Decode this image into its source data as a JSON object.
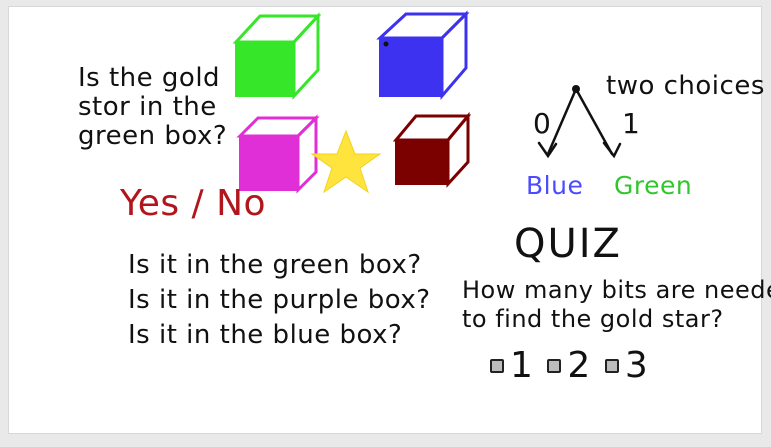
{
  "left_question": "Is the gold\nstor in the\ngreen box?",
  "yes_no": "Yes / No",
  "questions": "Is it in the green box?\nIs it in the purple box?\nIs it in the blue box?",
  "two_choices": "two choices",
  "zero": "0",
  "one": "1",
  "blue": "Blue",
  "green": "Green",
  "quiz": "QUIZ",
  "quiz_question": "How many bits are needed\nto find the gold star?",
  "options": [
    "1",
    "2",
    "3"
  ],
  "colors": {
    "green_box": "#35e629",
    "blue_box": "#3c32f0",
    "purple_box": "#e02fd6",
    "maroon_box": "#7b0000",
    "star": "#ffe43d",
    "red_text": "#b1161d"
  }
}
